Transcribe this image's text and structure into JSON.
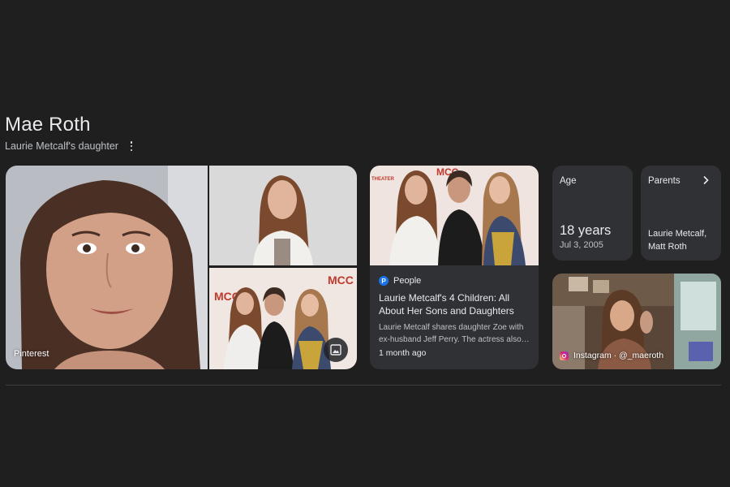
{
  "entity": {
    "name": "Mae Roth",
    "description": "Laurie Metcalf's daughter",
    "more_options_icon": "kebab-icon"
  },
  "gallery": {
    "main_source": "Pinterest",
    "images_icon": "image-icon",
    "sign_text_1": "MCC",
    "sign_text_2": "MCC"
  },
  "article": {
    "sign_text": "MCC",
    "sign_sub": "THEATER",
    "source": "People",
    "source_logo": "P",
    "title": "Laurie Metcalf's 4 Children: All About Her Sons and Daughters",
    "snippet": "Laurie Metcalf shares daughter Zoe with ex-husband Jeff Perry. The actress also…",
    "time": "1 month ago"
  },
  "age": {
    "label": "Age",
    "value": "18 years",
    "date": "Jul 3, 2005"
  },
  "parents": {
    "label": "Parents",
    "value": "Laurie Metcalf, Matt Roth",
    "chevron_icon": "chevron-right-icon"
  },
  "instagram": {
    "source": "Instagram · @_maeroth",
    "logo_icon": "instagram-icon"
  },
  "colors": {
    "background": "#1f1f1f",
    "card": "#303134",
    "text": "#e8eaed",
    "secondary_text": "#bdc1c6"
  }
}
